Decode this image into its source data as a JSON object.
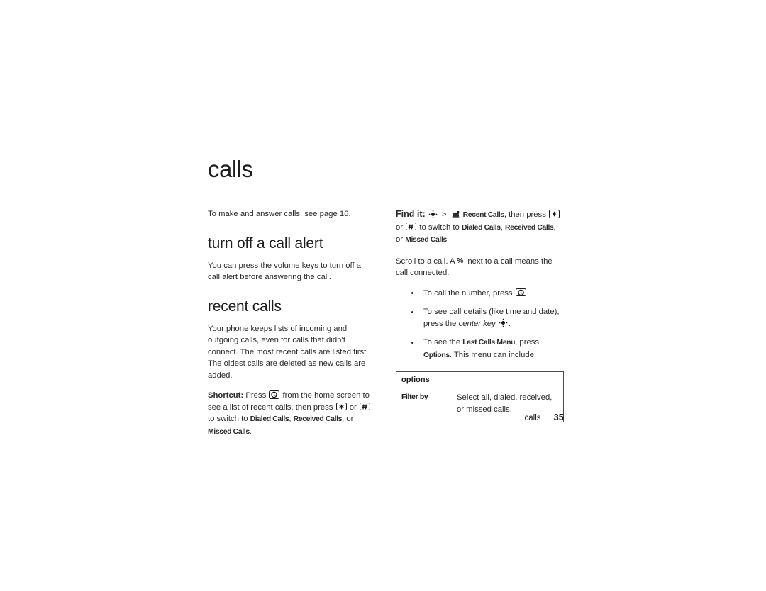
{
  "page": {
    "chapter_title": "calls",
    "footer": {
      "chapter": "calls",
      "page_number": "35"
    }
  },
  "left_column": {
    "intro": "To make and answer calls, see page 16.",
    "section_1": {
      "heading": "turn off a call alert",
      "body": "You can press the volume keys to turn off a call alert before answering the call."
    },
    "section_2": {
      "heading": "recent calls",
      "body": "Your phone keeps lists of incoming and outgoing calls, even for calls that didn’t connect. The most recent calls are listed first. The oldest calls are deleted as new calls are added.",
      "shortcut": {
        "label": "Shortcut:",
        "t1": "Press",
        "icon_send": "send-key-icon",
        "t2": "from the home screen to see a list of recent calls, then press",
        "icon_star": "✱",
        "t3": "or",
        "icon_pound": "#",
        "t4": "to switch to",
        "link_dialed": "Dialed Calls",
        "sep1": ",",
        "link_received": "Received Calls",
        "sep2": ", or",
        "link_missed": "Missed Calls",
        "end": "."
      }
    }
  },
  "right_column": {
    "find_it": {
      "label": "Find it:",
      "icon_nav": "nav-center-key-icon",
      "separator": ">",
      "icon_recent": "recent-calls-icon",
      "menu": "Recent Calls",
      "t1": ", then press",
      "icon_star": "✱",
      "t2": "or",
      "icon_pound": "#",
      "t3": "to switch to",
      "link_dialed": "Dialed Calls",
      "sep1": ",",
      "link_received": "Received Calls",
      "sep2": ", or",
      "link_missed": "Missed Calls"
    },
    "scroll_note": {
      "t1": "Scroll to a call. A",
      "symbol": "%",
      "t2": "next to a call means the call connected."
    },
    "bullets": [
      {
        "t1": "To call the number, press",
        "icon": "send-key-icon",
        "t2": "."
      },
      {
        "t1": "To see call details (like time and date), press the",
        "italic": "center key",
        "icon": "nav-center-key-icon",
        "t2": "."
      },
      {
        "t1": "To see the",
        "bold1": "Last Calls Menu",
        "t2": ", press",
        "bold2": "Options",
        "t3": ". This menu can include:"
      }
    ],
    "options_table": {
      "header": "options",
      "rows": [
        {
          "key": "Filter by",
          "value": "Select all, dialed, received, or missed calls."
        }
      ]
    }
  }
}
